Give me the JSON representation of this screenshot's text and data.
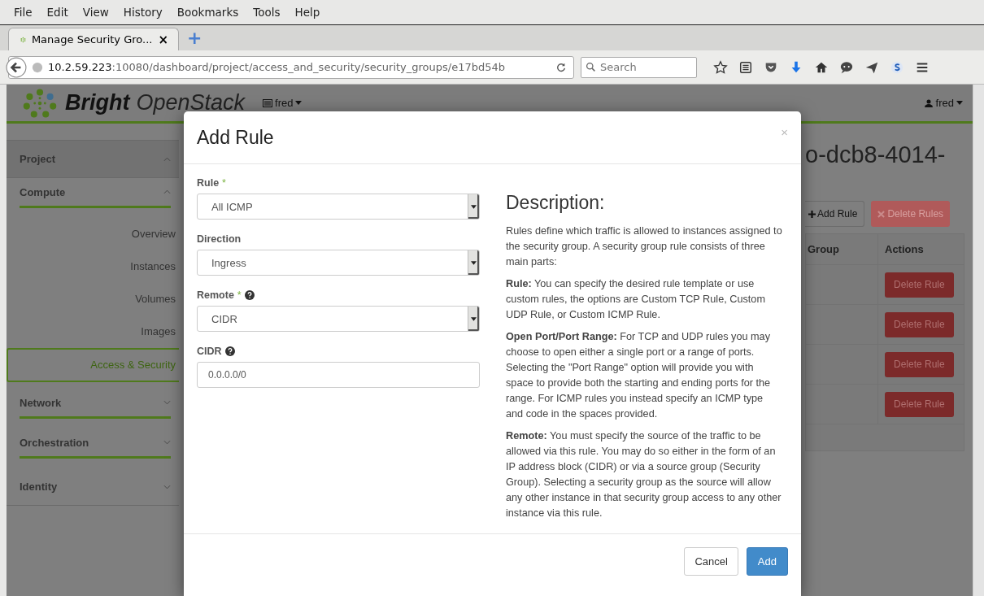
{
  "menu": [
    "File",
    "Edit",
    "View",
    "History",
    "Bookmarks",
    "Tools",
    "Help"
  ],
  "browser_tab": {
    "title": "Manage Security Gro...",
    "close": "×",
    "new_tab": "+"
  },
  "url": {
    "host": "10.2.59.223",
    "rest": ":10080/dashboard/project/access_and_security/security_groups/e17bd54b"
  },
  "search": {
    "placeholder": "Search"
  },
  "header": {
    "brand_bold": "Bright",
    "brand_light": "OpenStack",
    "project": "fred",
    "user": "fred"
  },
  "sidebar": [
    {
      "label": "Project",
      "expanded": true,
      "children": [
        {
          "label": "Compute",
          "expanded": true,
          "children": [
            {
              "label": "Overview",
              "selected": false
            },
            {
              "label": "Instances",
              "selected": false
            },
            {
              "label": "Volumes",
              "selected": false
            },
            {
              "label": "Images",
              "selected": false
            },
            {
              "label": "Access & Security",
              "selected": true
            }
          ]
        },
        {
          "label": "Network",
          "expanded": false
        },
        {
          "label": "Orchestration",
          "expanded": false
        }
      ]
    },
    {
      "label": "Identity",
      "expanded": false
    }
  ],
  "page": {
    "title": "o-dcb8-4014-",
    "add_button": "Add Rule",
    "delete_button": "Delete Rules",
    "columns": [
      "Group",
      "Actions"
    ],
    "rows": [
      {
        "action": "Delete Rule"
      },
      {
        "action": "Delete Rule"
      },
      {
        "action": "Delete Rule"
      },
      {
        "action": "Delete Rule"
      }
    ]
  },
  "modal": {
    "title": "Add Rule",
    "close": "×",
    "fields": [
      {
        "kind": "select",
        "label": "Rule",
        "required_mark": "*",
        "help": false,
        "value": "All ICMP"
      },
      {
        "kind": "select",
        "label": "Direction",
        "help": false,
        "value": "Ingress"
      },
      {
        "kind": "select",
        "label": "Remote",
        "required_mark": "*",
        "help": true,
        "value": "CIDR"
      },
      {
        "kind": "text",
        "label": "CIDR",
        "help": true,
        "value": "0.0.0.0/0"
      }
    ],
    "description_title": "Description:",
    "description": [
      "Rules define which traffic is allowed to instances assigned to the security group. A security group rule consists of three main parts:",
      "**Rule:** You can specify the desired rule template or use custom rules, the options are Custom TCP Rule, Custom UDP Rule, or Custom ICMP Rule.",
      "**Open Port/Port Range:** For TCP and UDP rules you may choose to open either a single port or a range of ports. Selecting the \"Port Range\" option will provide you with space to provide both the starting and ending ports for the range. For ICMP rules you instead specify an ICMP type and code in the spaces provided.",
      "**Remote:** You must specify the source of the traffic to be allowed via this rule. You may do so either in the form of an IP address block (CIDR) or via a source group (Security Group). Selecting a security group as the source will allow any other instance in that security group access to any other instance via this rule."
    ],
    "cancel": "Cancel",
    "submit": "Add"
  }
}
